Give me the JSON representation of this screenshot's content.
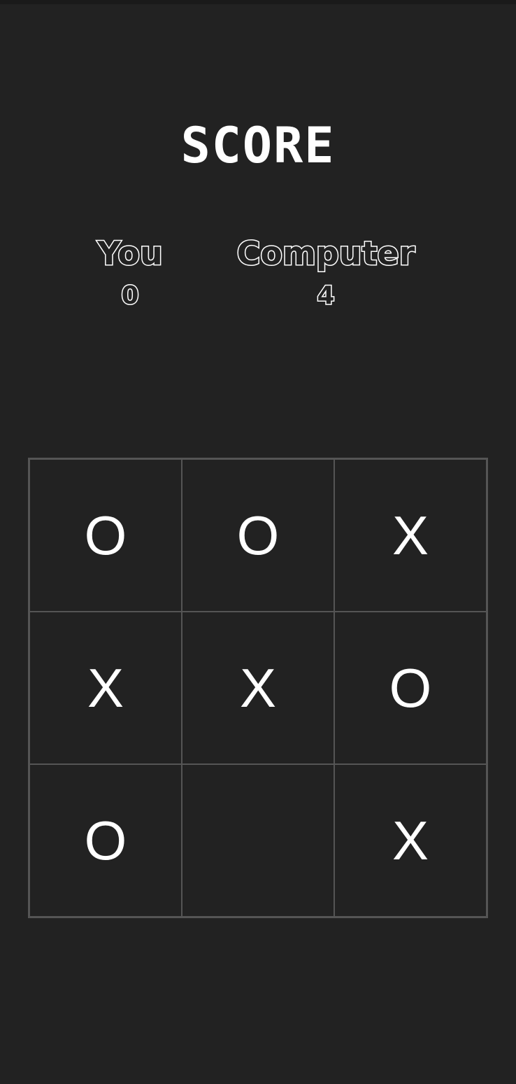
{
  "header": {
    "title": "SCORE"
  },
  "scores": {
    "you": {
      "label": "You",
      "value": "0"
    },
    "computer": {
      "label": "Computer",
      "value": "4"
    }
  },
  "board": {
    "cells": [
      "O",
      "O",
      "X",
      "X",
      "X",
      "O",
      "O",
      "",
      "X"
    ]
  },
  "colors": {
    "background": "#222222",
    "grid_line": "#555555",
    "text": "#ffffff"
  }
}
